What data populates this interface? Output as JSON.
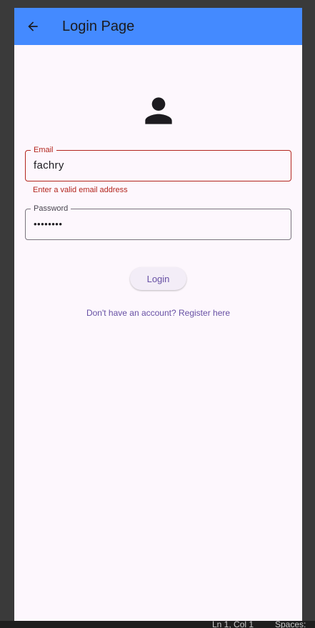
{
  "appbar": {
    "title": "Login Page",
    "back_icon": "arrow-back-icon",
    "color": "#448aff"
  },
  "avatar": {
    "icon": "person-icon"
  },
  "email": {
    "label": "Email",
    "value": "fachry",
    "error": "Enter a valid email address"
  },
  "password": {
    "label": "Password",
    "value": "••••••••"
  },
  "login_button": {
    "label": "Login"
  },
  "register_link": {
    "label": "Don't have an account? Register here"
  },
  "editor_status": {
    "position": "Ln 1, Col 1",
    "spaces": "Spaces:"
  },
  "colors": {
    "background": "#fdf7fd",
    "error": "#b3261e",
    "primary": "#6750a4"
  }
}
